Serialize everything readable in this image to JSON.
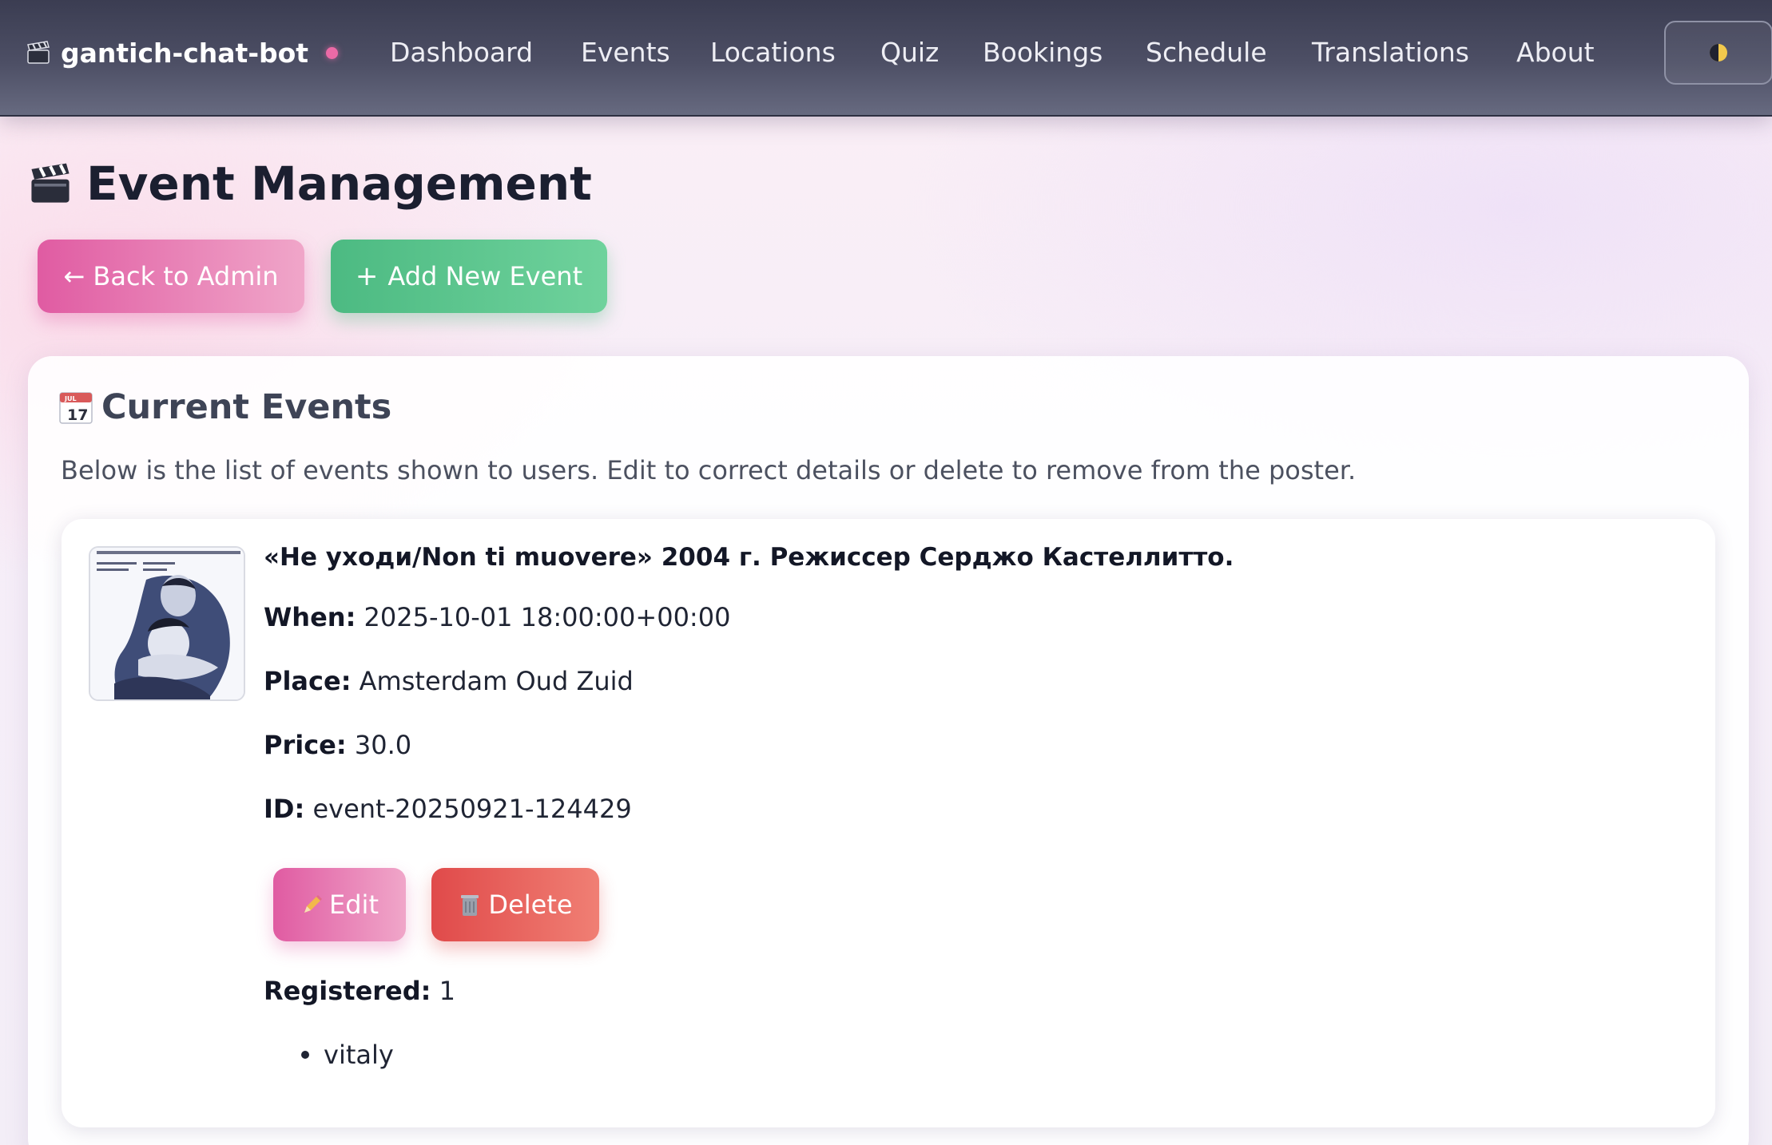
{
  "nav": {
    "brand": "gantich-chat-bot",
    "links": [
      "Dashboard",
      "Events",
      "Locations",
      "Quiz",
      "Bookings",
      "Schedule",
      "Translations",
      "About"
    ]
  },
  "page": {
    "title": "Event Management",
    "back_button": "← Back to Admin",
    "add_button": "Add New Event",
    "add_icon": "+"
  },
  "panel": {
    "title": "Current Events",
    "calendar_month": "JUL",
    "calendar_day": "17",
    "description": "Below is the list of events shown to users. Edit to correct details or delete to remove from the poster."
  },
  "event": {
    "title": "«Не уходи/Non ti muovere» 2004 г. Режиссер Серджо Кастеллитто.",
    "when_label": "When:",
    "when": "2025-10-01 18:00:00+00:00",
    "place_label": "Place:",
    "place": "Amsterdam Oud Zuid",
    "price_label": "Price:",
    "price": "30.0",
    "id_label": "ID:",
    "id": "event-20250921-124429",
    "edit_button": "Edit",
    "delete_button": "Delete",
    "registered_label": "Registered:",
    "registered_count": "1",
    "registrants": [
      "vitaly"
    ]
  },
  "colors": {
    "accent_pink": "#e05ba2",
    "accent_green": "#4cba82",
    "danger_red": "#e04a4a",
    "nav_bg": "#4d4f65",
    "status_dot": "#ec6aa6"
  },
  "icons": {
    "brand": "clapperboard-icon",
    "title": "clapperboard-icon",
    "panel": "calendar-icon",
    "theme": "half-moon-icon",
    "edit": "pencil-icon",
    "delete": "trash-icon"
  }
}
